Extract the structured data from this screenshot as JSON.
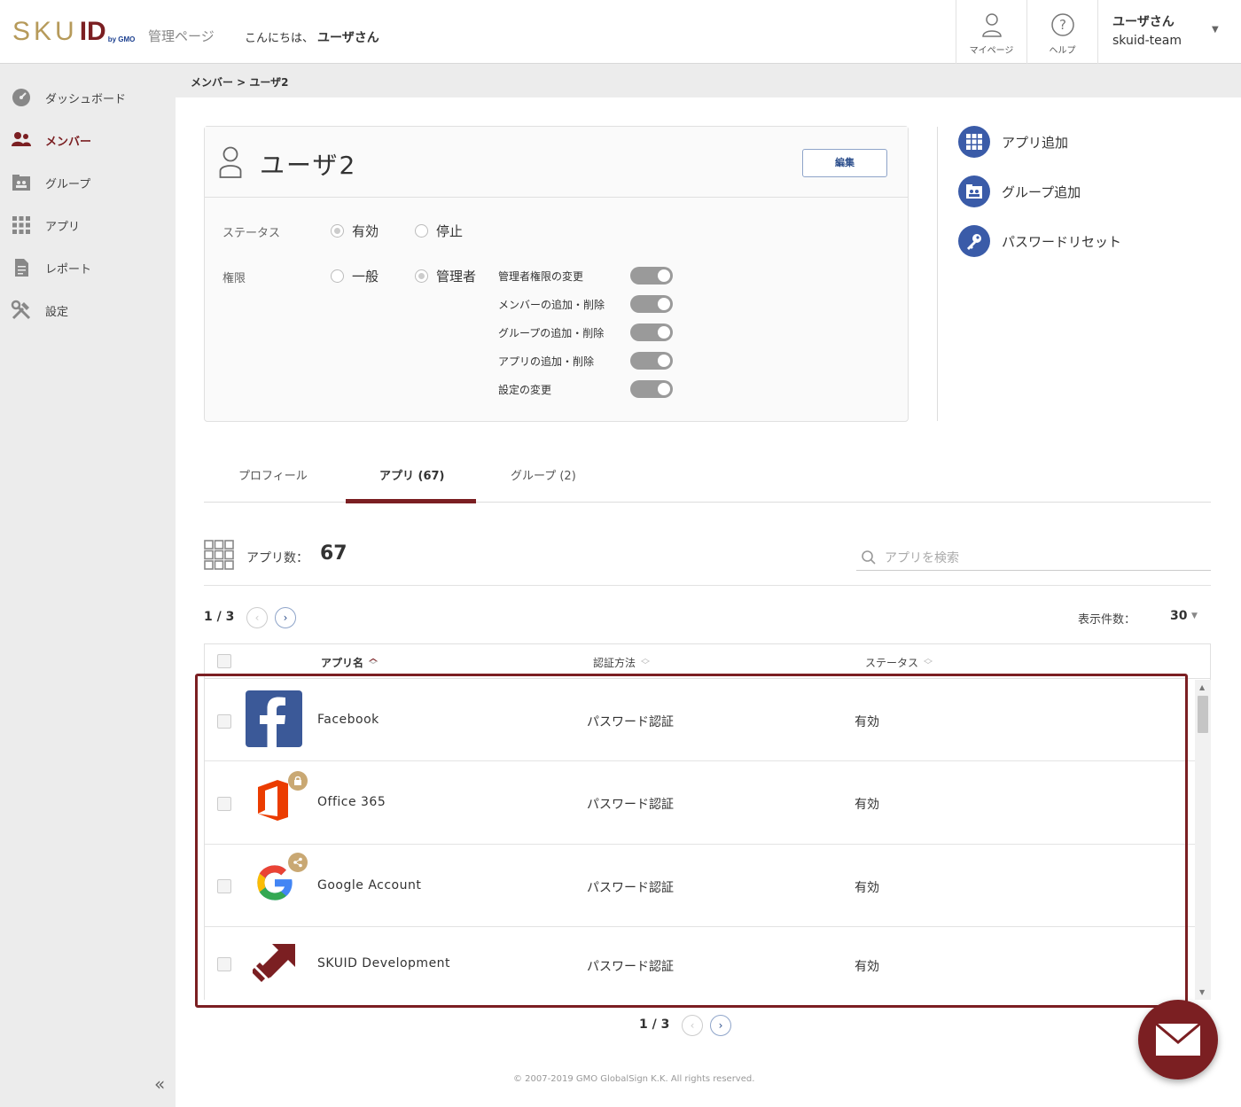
{
  "header": {
    "logo_sku": "SKU",
    "logo_id": "ID",
    "logo_gmo": "by GMO",
    "admin_label": "管理ページ",
    "greeting": "こんにちは、",
    "greeting_user": "ユーザさん",
    "mypage_label": "マイページ",
    "help_label": "ヘルプ",
    "user_name": "ユーザさん",
    "team_name": "skuid-team"
  },
  "sidebar": {
    "items": [
      {
        "label": "ダッシュボード",
        "icon": "dashboard-icon"
      },
      {
        "label": "メンバー",
        "icon": "members-icon",
        "active": true
      },
      {
        "label": "グループ",
        "icon": "group-icon"
      },
      {
        "label": "アプリ",
        "icon": "apps-grid-icon"
      },
      {
        "label": "レポート",
        "icon": "report-icon"
      },
      {
        "label": "設定",
        "icon": "settings-tools-icon"
      }
    ],
    "collapse": "«"
  },
  "breadcrumb": "メンバー > ユーザ2",
  "profile": {
    "name": "ユーザ2",
    "edit_label": "編集",
    "status_label": "ステータス",
    "status_options": [
      "有効",
      "停止"
    ],
    "status_selected": "有効",
    "role_label": "権限",
    "role_options": [
      "一般",
      "管理者"
    ],
    "role_selected": "管理者",
    "permissions": [
      {
        "label": "管理者権限の変更",
        "on": true
      },
      {
        "label": "メンバーの追加・削除",
        "on": true
      },
      {
        "label": "グループの追加・削除",
        "on": true
      },
      {
        "label": "アプリの追加・削除",
        "on": true
      },
      {
        "label": "設定の変更",
        "on": true
      }
    ]
  },
  "actions": [
    {
      "label": "アプリ追加",
      "icon": "grid-icon"
    },
    {
      "label": "グループ追加",
      "icon": "group-folder-icon"
    },
    {
      "label": "パスワードリセット",
      "icon": "key-icon"
    }
  ],
  "tabs": [
    {
      "label": "プロフィール"
    },
    {
      "label": "アプリ (67)",
      "active": true
    },
    {
      "label": "グループ (2)"
    }
  ],
  "apps": {
    "count_label": "アプリ数：",
    "count": "67",
    "search_placeholder": "アプリを検索",
    "page": "1 / 3",
    "per_page_label": "表示件数：",
    "per_page": "30",
    "columns": [
      "アプリ名",
      "認証方法",
      "ステータス"
    ],
    "rows": [
      {
        "name": "Facebook",
        "auth": "パスワード認証",
        "status": "有効",
        "icon": "facebook-icon"
      },
      {
        "name": "Office 365",
        "auth": "パスワード認証",
        "status": "有効",
        "icon": "office365-icon",
        "badge": "lock-icon"
      },
      {
        "name": "Google Account",
        "auth": "パスワード認証",
        "status": "有効",
        "icon": "google-icon",
        "badge": "share-icon"
      },
      {
        "name": "SKUID Development",
        "auth": "パスワード認証",
        "status": "有効",
        "icon": "skuid-icon"
      }
    ]
  },
  "footer": "© 2007-2019 GMO GlobalSign K.K. All rights reserved.",
  "colors": {
    "brand": "#7b1f22",
    "accent_blue": "#3a5ba8",
    "gold": "#b69a5a"
  }
}
